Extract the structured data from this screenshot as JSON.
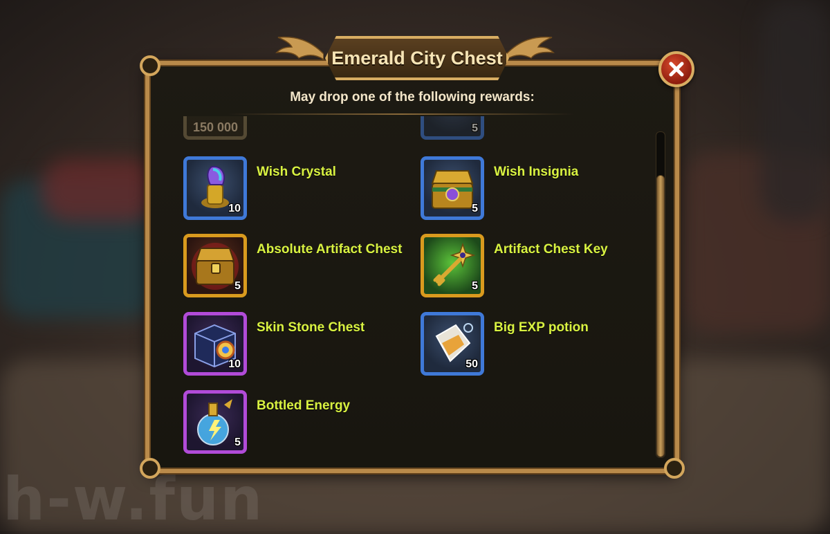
{
  "dialog": {
    "title": "Emerald City Chest",
    "subtitle": "May drop one of the following rewards:",
    "close_icon": "close-x-icon"
  },
  "peek_row": {
    "left_value": "150 000",
    "right_value": "5"
  },
  "rewards": [
    {
      "label": "Wish Crystal",
      "quantity": "10",
      "frame": "blue",
      "icon": "wish-crystal-icon"
    },
    {
      "label": "Wish Insignia",
      "quantity": "5",
      "frame": "blue",
      "icon": "wish-insignia-chest-icon"
    },
    {
      "label": "Absolute Artifact Chest",
      "quantity": "5",
      "frame": "orange",
      "icon": "artifact-chest-icon"
    },
    {
      "label": "Artifact Chest Key",
      "quantity": "5",
      "frame": "orange",
      "icon": "key-icon"
    },
    {
      "label": "Skin Stone Chest",
      "quantity": "10",
      "frame": "purple",
      "icon": "skin-stone-chest-icon"
    },
    {
      "label": "Big EXP potion",
      "quantity": "50",
      "frame": "blue",
      "icon": "exp-potion-icon"
    },
    {
      "label": "Bottled Energy",
      "quantity": "5",
      "frame": "purple",
      "icon": "energy-bottle-icon"
    }
  ],
  "watermark": "h-w.fun",
  "colors": {
    "label_yellow": "#d9f241",
    "frame_blue": "#3f79d8",
    "frame_orange": "#d99a1e",
    "frame_purple": "#b14bd8",
    "gold_trim": "#d8ad62"
  }
}
